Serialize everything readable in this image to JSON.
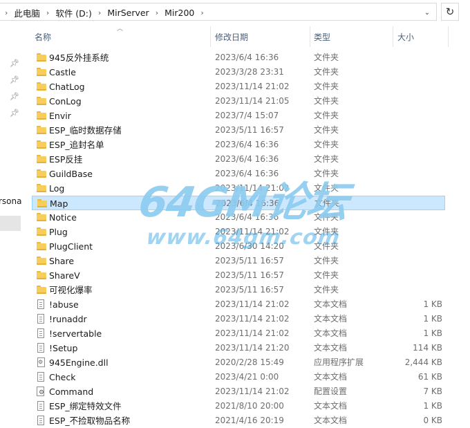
{
  "address_bar": {
    "crumbs": [
      "此电脑",
      "软件 (D:)",
      "MirServer",
      "Mir200"
    ],
    "refresh_icon": "refresh-icon",
    "dropdown_icon": "chevron-down-icon"
  },
  "nav": {
    "partial_label": "rsona"
  },
  "columns": {
    "name": "名称",
    "date": "修改日期",
    "type": "类型",
    "size": "大小"
  },
  "files": [
    {
      "name": "945反外挂系统",
      "date": "2023/6/4 16:36",
      "type": "文件夹",
      "size": "",
      "icon": "folder-icon"
    },
    {
      "name": "Castle",
      "date": "2023/3/28 23:31",
      "type": "文件夹",
      "size": "",
      "icon": "folder-icon"
    },
    {
      "name": "ChatLog",
      "date": "2023/11/14 21:02",
      "type": "文件夹",
      "size": "",
      "icon": "folder-icon"
    },
    {
      "name": "ConLog",
      "date": "2023/11/14 21:05",
      "type": "文件夹",
      "size": "",
      "icon": "folder-icon"
    },
    {
      "name": "Envir",
      "date": "2023/7/4 15:07",
      "type": "文件夹",
      "size": "",
      "icon": "folder-icon"
    },
    {
      "name": "ESP_临时数据存储",
      "date": "2023/5/11 16:57",
      "type": "文件夹",
      "size": "",
      "icon": "folder-icon"
    },
    {
      "name": "ESP_追封名单",
      "date": "2023/6/4 16:36",
      "type": "文件夹",
      "size": "",
      "icon": "folder-icon"
    },
    {
      "name": "ESP反挂",
      "date": "2023/6/4 16:36",
      "type": "文件夹",
      "size": "",
      "icon": "folder-icon"
    },
    {
      "name": "GuildBase",
      "date": "2023/6/4 16:36",
      "type": "文件夹",
      "size": "",
      "icon": "folder-icon"
    },
    {
      "name": "Log",
      "date": "2023/11/14 21:02",
      "type": "文件夹",
      "size": "",
      "icon": "folder-icon"
    },
    {
      "name": "Map",
      "date": "2023/6/4 16:36",
      "type": "文件夹",
      "size": "",
      "icon": "folder-icon",
      "selected": true
    },
    {
      "name": "Notice",
      "date": "2023/6/4 16:36",
      "type": "文件夹",
      "size": "",
      "icon": "folder-icon"
    },
    {
      "name": "Plug",
      "date": "2023/11/14 21:02",
      "type": "文件夹",
      "size": "",
      "icon": "folder-icon"
    },
    {
      "name": "PlugClient",
      "date": "2023/6/30 14:20",
      "type": "文件夹",
      "size": "",
      "icon": "folder-icon"
    },
    {
      "name": "Share",
      "date": "2023/5/11 16:57",
      "type": "文件夹",
      "size": "",
      "icon": "folder-icon"
    },
    {
      "name": "ShareV",
      "date": "2023/5/11 16:57",
      "type": "文件夹",
      "size": "",
      "icon": "folder-icon"
    },
    {
      "name": "可视化爆率",
      "date": "2023/5/11 16:57",
      "type": "文件夹",
      "size": "",
      "icon": "folder-icon"
    },
    {
      "name": "!abuse",
      "date": "2023/11/14 21:02",
      "type": "文本文档",
      "size": "1 KB",
      "icon": "text-file-icon"
    },
    {
      "name": "!runaddr",
      "date": "2023/11/14 21:02",
      "type": "文本文档",
      "size": "1 KB",
      "icon": "text-file-icon"
    },
    {
      "name": "!servertable",
      "date": "2023/11/14 21:02",
      "type": "文本文档",
      "size": "1 KB",
      "icon": "text-file-icon"
    },
    {
      "name": "!Setup",
      "date": "2023/11/14 21:20",
      "type": "文本文档",
      "size": "114 KB",
      "icon": "text-file-icon"
    },
    {
      "name": "945Engine.dll",
      "date": "2020/2/28 15:49",
      "type": "应用程序扩展",
      "size": "2,444 KB",
      "icon": "dll-file-icon"
    },
    {
      "name": "Check",
      "date": "2023/4/21 0:00",
      "type": "文本文档",
      "size": "61 KB",
      "icon": "text-file-icon"
    },
    {
      "name": "Command",
      "date": "2023/11/14 21:02",
      "type": "配置设置",
      "size": "7 KB",
      "icon": "config-file-icon"
    },
    {
      "name": "ESP_绑定特效文件",
      "date": "2021/8/10 20:00",
      "type": "文本文档",
      "size": "1 KB",
      "icon": "text-file-icon"
    },
    {
      "name": "ESP_不捡取物品名称",
      "date": "2021/4/16 20:19",
      "type": "文本文档",
      "size": "0 KB",
      "icon": "text-file-icon"
    }
  ],
  "watermark": {
    "line1": "64GM论坛",
    "line2": "www.64gm.com"
  },
  "colors": {
    "selection_bg": "#cce8ff",
    "selection_border": "#99d1ff",
    "folder": "#f7ce5c",
    "header_text": "#4c607a",
    "watermark": "#40aae6"
  }
}
